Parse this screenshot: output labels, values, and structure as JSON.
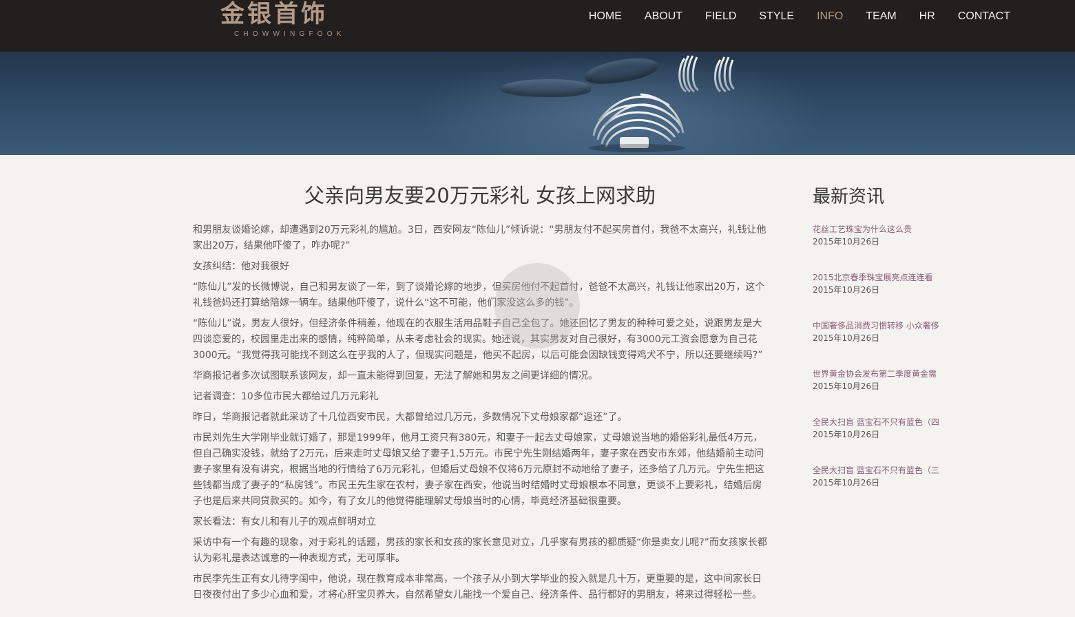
{
  "brand": {
    "name_cn": "金银首饰",
    "name_en": "CHOWWINGFOOK"
  },
  "nav": [
    {
      "label": "HOME",
      "active": false
    },
    {
      "label": "ABOUT",
      "active": false
    },
    {
      "label": "FIELD",
      "active": false
    },
    {
      "label": "STYLE",
      "active": false
    },
    {
      "label": "INFO",
      "active": true
    },
    {
      "label": "TEAM",
      "active": false
    },
    {
      "label": "HR",
      "active": false
    },
    {
      "label": "CONTACT",
      "active": false
    }
  ],
  "article": {
    "title": "父亲向男友要20万元彩礼 女孩上网求助",
    "paragraphs": [
      "和男朋友谈婚论嫁，却遭遇到20万元彩礼的尴尬。3日，西安网友“陈仙儿”倾诉说：“男朋友付不起买房首付，我爸不太高兴，礼钱让他家出20万，结果他吓傻了，咋办呢?”",
      "女孩纠结：他对我很好",
      "“陈仙儿”发的长微博说，自己和男友谈了一年，到了谈婚论嫁的地步，但买房他付不起首付，爸爸不太高兴，礼钱让他家出20万，这个礼钱爸妈还打算给陪嫁一辆车。结果他吓傻了，说什么“这不可能，他们家没这么多的钱”。",
      "“陈仙儿”说，男友人很好，但经济条件稍差，他现在的衣服生活用品鞋子自己全包了。她还回忆了男友的种种可爱之处，说跟男友是大四谈恋爱的，校园里走出来的感情，纯粹简单，从未考虑社会的现实。她还说，其实男友对自己很好，有3000元工资会愿意为自己花3000元。“我觉得我可能找不到这么在乎我的人了，但现实问题是，他买不起房，以后可能会因缺钱变得鸡犬不宁，所以还要继续吗?”",
      "华商报记者多次试图联系该网友，却一直未能得到回复，无法了解她和男友之间更详细的情况。",
      "记者调查：10多位市民大都给过几万元彩礼",
      "昨日，华商报记者就此采访了十几位西安市民，大都曾给过几万元，多数情况下丈母娘家都“返还”了。",
      "市民刘先生大学刚毕业就订婚了，那是1999年，他月工资只有380元，和妻子一起去丈母娘家，丈母娘说当地的婚俗彩礼最低4万元，但自己确实没钱，就给了2万元，后来走时丈母娘又给了妻子1.5万元。市民宁先生刚结婚两年，妻子家在西安市东郊，他结婚前主动问妻子家里有没有讲究，根据当地的行情给了6万元彩礼，但婚后丈母娘不仅将6万元原封不动地给了妻子，还多给了几万元。宁先生把这些钱都当成了妻子的“私房钱”。市民王先生家在农村，妻子家在西安，他说当时结婚时丈母娘根本不同意，更谈不上要彩礼，结婚后房子也是后来共同贷款买的。如今，有了女儿的他觉得能理解丈母娘当时的心情，毕竟经济基础很重要。",
      "家长看法：有女儿和有儿子的观点鲜明对立",
      "采访中有一个有趣的现象，对于彩礼的话题，男孩的家长和女孩的家长意见对立，几乎家有男孩的都质疑“你是卖女儿呢?”而女孩家长都认为彩礼是表达诚意的一种表现方式，无可厚非。",
      "市民李先生正有女儿待字闺中，他说，现在教育成本非常高，一个孩子从小到大学毕业的投入就是几十万，更重要的是，这中间家长日日夜夜付出了多少心血和爱，才将心肝宝贝养大，自然希望女儿能找一个爱自己、经济条件、品行都好的男朋友，将来过得轻松一些。"
    ]
  },
  "sidebar": {
    "title": "最新资讯",
    "news": [
      {
        "title": "花丝工艺珠宝为什么这么贵",
        "date": "2015年10月26日"
      },
      {
        "title": "2015北京春季珠宝展亮点连连看",
        "date": "2015年10月26日"
      },
      {
        "title": "中国奢侈品消费习惯转移 小众奢侈",
        "date": "2015年10月26日"
      },
      {
        "title": "世界黄金协会发布第二季度黄金需",
        "date": "2015年10月26日"
      },
      {
        "title": "全民大扫盲 蓝宝石不只有蓝色（四",
        "date": "2015年10月26日"
      },
      {
        "title": "全民大扫盲 蓝宝石不只有蓝色（三",
        "date": "2015年10月26日"
      }
    ]
  },
  "colors": {
    "header_bg": "#231f1e",
    "brand": "#b29a86",
    "nav_active": "#b3987f",
    "link": "#8b5a79",
    "page_bg": "#f4f3ef"
  }
}
